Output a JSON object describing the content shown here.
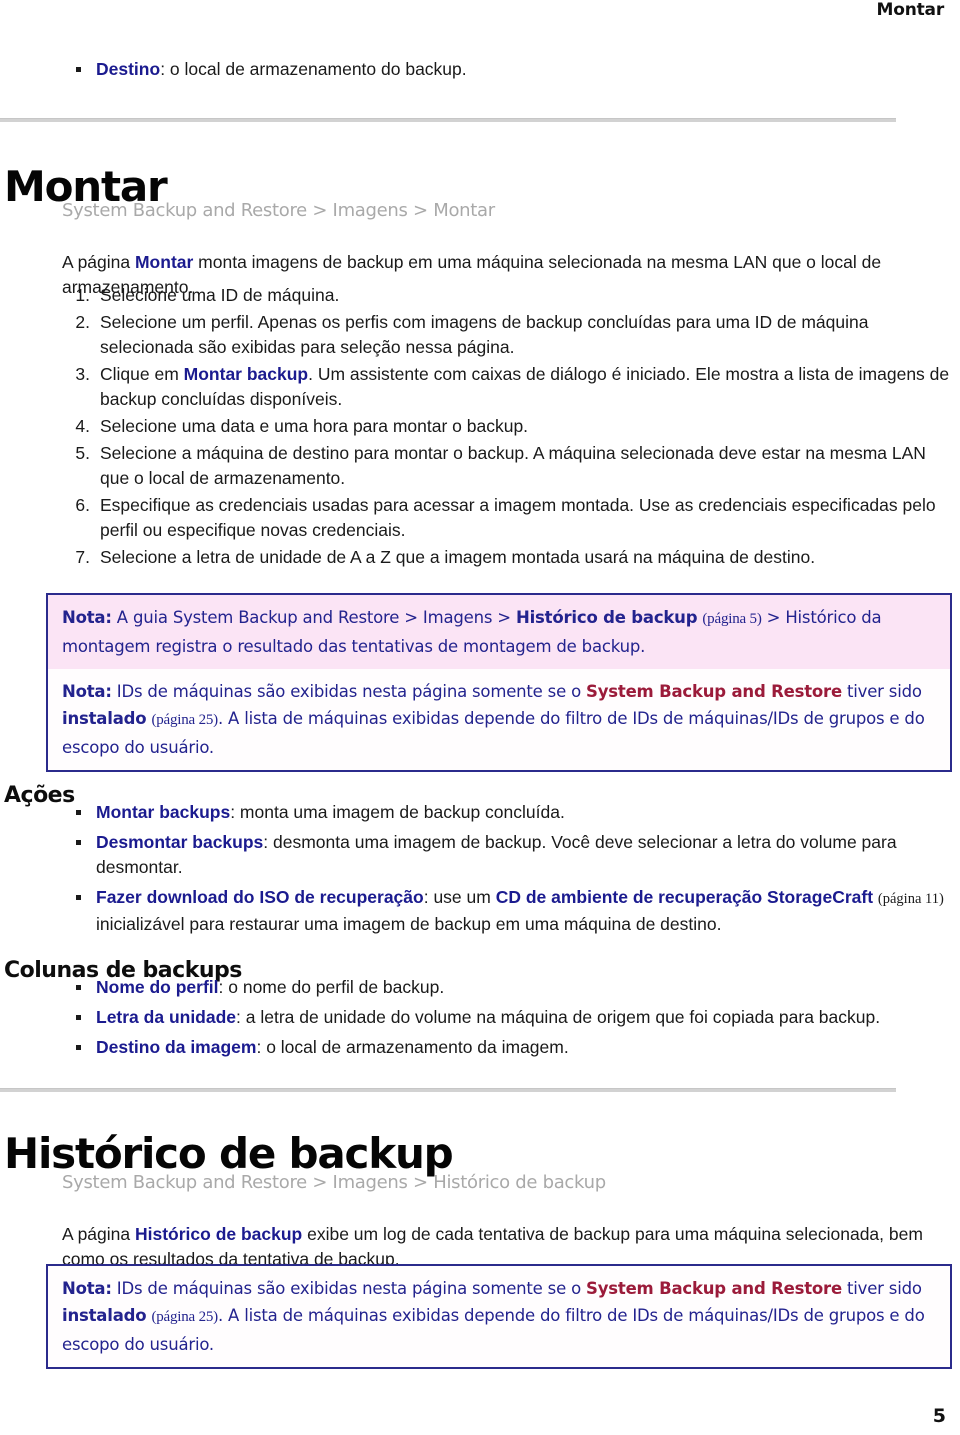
{
  "header": {
    "running_title": "Montar"
  },
  "top_bullet": {
    "term": "Destino",
    "rest": ": o local de armazenamento do backup."
  },
  "montar_section": {
    "title": "Montar",
    "breadcrumb": "System Backup and Restore > Imagens > Montar",
    "intro_pre": "A página ",
    "intro_link": "Montar",
    "intro_post": " monta imagens de backup em uma máquina selecionada na mesma LAN que o local de armazenamento.",
    "steps": [
      {
        "text": "Selecione uma ID de máquina."
      },
      {
        "text": "Selecione um perfil. Apenas os perfis com imagens de backup concluídas para uma ID de máquina selecionada são exibidas para seleção nessa página."
      },
      {
        "pre": "Clique em ",
        "link": "Montar backup",
        "post": ". Um assistente com caixas de diálogo é iniciado. Ele mostra a lista de imagens de backup concluídas disponíveis."
      },
      {
        "text": "Selecione uma data e uma hora para montar o backup."
      },
      {
        "text": "Selecione a máquina de destino para montar o backup. A máquina selecionada deve estar na mesma LAN que o local de armazenamento."
      },
      {
        "text": "Especifique as credenciais usadas para acessar a imagem montada. Use as credenciais especificadas pelo perfil ou especifique novas credenciais."
      },
      {
        "text": "Selecione a letra de unidade de A a Z que a imagem montada usará na máquina de destino."
      }
    ],
    "notes": [
      {
        "style": "pink",
        "label": "Nota:",
        "seg1": " A guia System Backup and Restore > Imagens > ",
        "bold1": "Histórico de backup",
        "pageref": "(página 5)",
        "seg2": " > Histórico da montagem registra o resultado das tentativas de montagem de backup."
      },
      {
        "style": "plain",
        "label": "Nota:",
        "seg1": " IDs de máquinas são exibidas nesta página somente se o ",
        "product": "System Backup and Restore",
        "seg2": " tiver sido ",
        "bold1": "instalado",
        "pageref": "(página 25)",
        "seg3": ". A lista de máquinas exibidas depende do filtro de IDs de máquinas/IDs de grupos e do escopo do usuário."
      }
    ]
  },
  "acoes": {
    "heading": "Ações",
    "items": [
      {
        "term": "Montar backups",
        "rest": ": monta uma imagem de backup concluída."
      },
      {
        "term": "Desmontar backups",
        "rest": ": desmonta uma imagem de backup. Você deve selecionar a letra do volume para desmontar."
      },
      {
        "term": "Fazer download do ISO de recuperação",
        "mid": ": use um ",
        "link2": "CD de ambiente de recuperação StorageCraft",
        "pageref": "(página 11)",
        "rest": " inicializável para restaurar uma imagem de backup em uma máquina de destino."
      }
    ]
  },
  "colunas": {
    "heading": "Colunas de backups",
    "items": [
      {
        "term": "Nome do perfil",
        "rest": ": o nome do perfil de backup."
      },
      {
        "term": "Letra da unidade",
        "rest": ": a letra de unidade do volume na máquina de origem que foi copiada para backup."
      },
      {
        "term": "Destino da imagem",
        "rest": ": o local de armazenamento da imagem."
      }
    ]
  },
  "historico_section": {
    "title": "Histórico de backup",
    "breadcrumb": "System Backup and Restore > Imagens > Histórico de backup",
    "intro_pre": "A página ",
    "intro_link": "Histórico de backup",
    "intro_post": " exibe um log de cada tentativa de backup para uma máquina selecionada, bem como os resultados da tentativa de backup.",
    "note": {
      "label": "Nota:",
      "seg1": " IDs de máquinas são exibidas nesta página somente se o ",
      "product": "System Backup and Restore",
      "seg2": " tiver sido ",
      "bold1": "instalado",
      "pageref": "(página 25)",
      "seg3": ". A lista de máquinas exibidas depende do filtro de IDs de máquinas/IDs de grupos e do escopo do usuário."
    }
  },
  "footer": {
    "page_number": "5"
  },
  "colors": {
    "link_blue": "#1b1b8f",
    "note_text": "#23238e",
    "note_border": "#2b2b8c",
    "note_pink_bg": "#fbe4f5",
    "product_red": "#9b1b3a",
    "breadcrumb_gray": "#a9a9a9",
    "rule_gray": "#d2d2d2"
  }
}
